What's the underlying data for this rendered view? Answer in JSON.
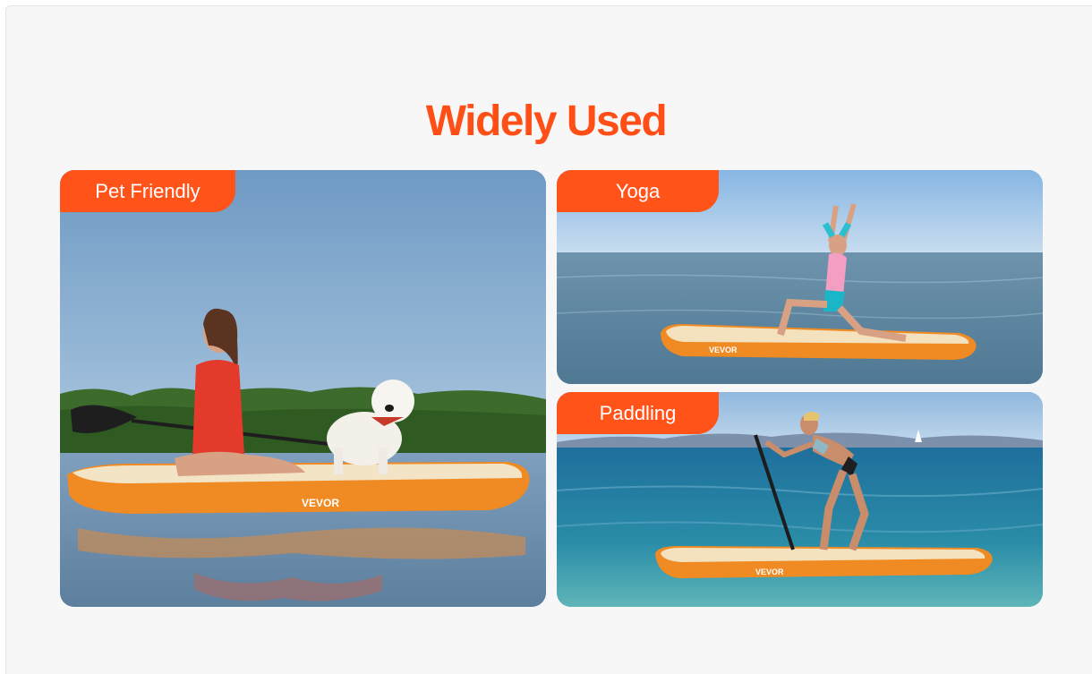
{
  "heading": "Widely Used",
  "cards": [
    {
      "label": "Pet Friendly",
      "board_brand": "VEVOR"
    },
    {
      "label": "Yoga",
      "board_brand": "VEVOR"
    },
    {
      "label": "Paddling",
      "board_brand": "VEVOR"
    }
  ],
  "colors": {
    "accent": "#ff5319",
    "heading": "#ff4f17",
    "panel_background": "#f7f7f7"
  }
}
